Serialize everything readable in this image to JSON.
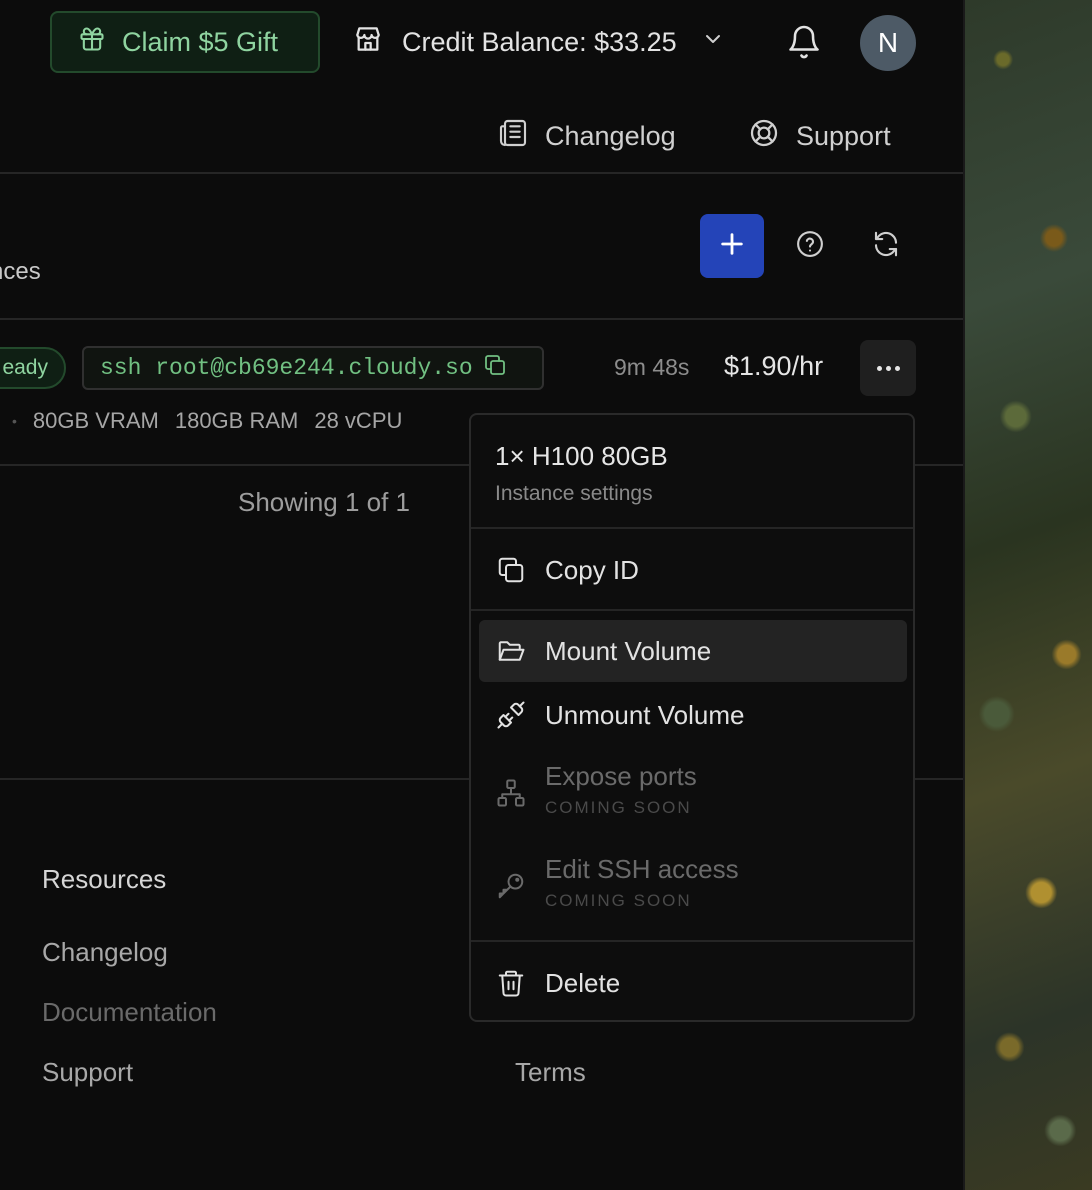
{
  "header": {
    "gift_label": "Claim $5 Gift",
    "credit_label": "Credit Balance: $33.25",
    "avatar_initial": "N"
  },
  "subnav": {
    "changelog": "Changelog",
    "support": "Support"
  },
  "section": {
    "title_partial": "nces"
  },
  "instance": {
    "status_partial": "eady",
    "ssh_command": "ssh root@cb69e244.cloudy.so",
    "uptime": "9m 48s",
    "price": "$1.90/hr",
    "specs": [
      "80GB VRAM",
      "180GB RAM",
      "28 vCPU"
    ]
  },
  "pagination": {
    "text": "Showing 1 of 1"
  },
  "footer": {
    "resources_heading": "Resources",
    "links": [
      "Changelog",
      "Documentation",
      "Support"
    ],
    "terms": "Terms"
  },
  "menu": {
    "title": "1× H100 80GB",
    "subtitle": "Instance settings",
    "copy_id": "Copy ID",
    "mount_volume": "Mount Volume",
    "unmount_volume": "Unmount Volume",
    "expose_ports": "Expose ports",
    "expose_ports_note": "COMING SOON",
    "edit_ssh": "Edit SSH access",
    "edit_ssh_note": "COMING SOON",
    "delete": "Delete"
  },
  "colors": {
    "accent_blue": "#2444b8",
    "success_green": "#8fd4a0",
    "background": "#0c0c0c"
  }
}
